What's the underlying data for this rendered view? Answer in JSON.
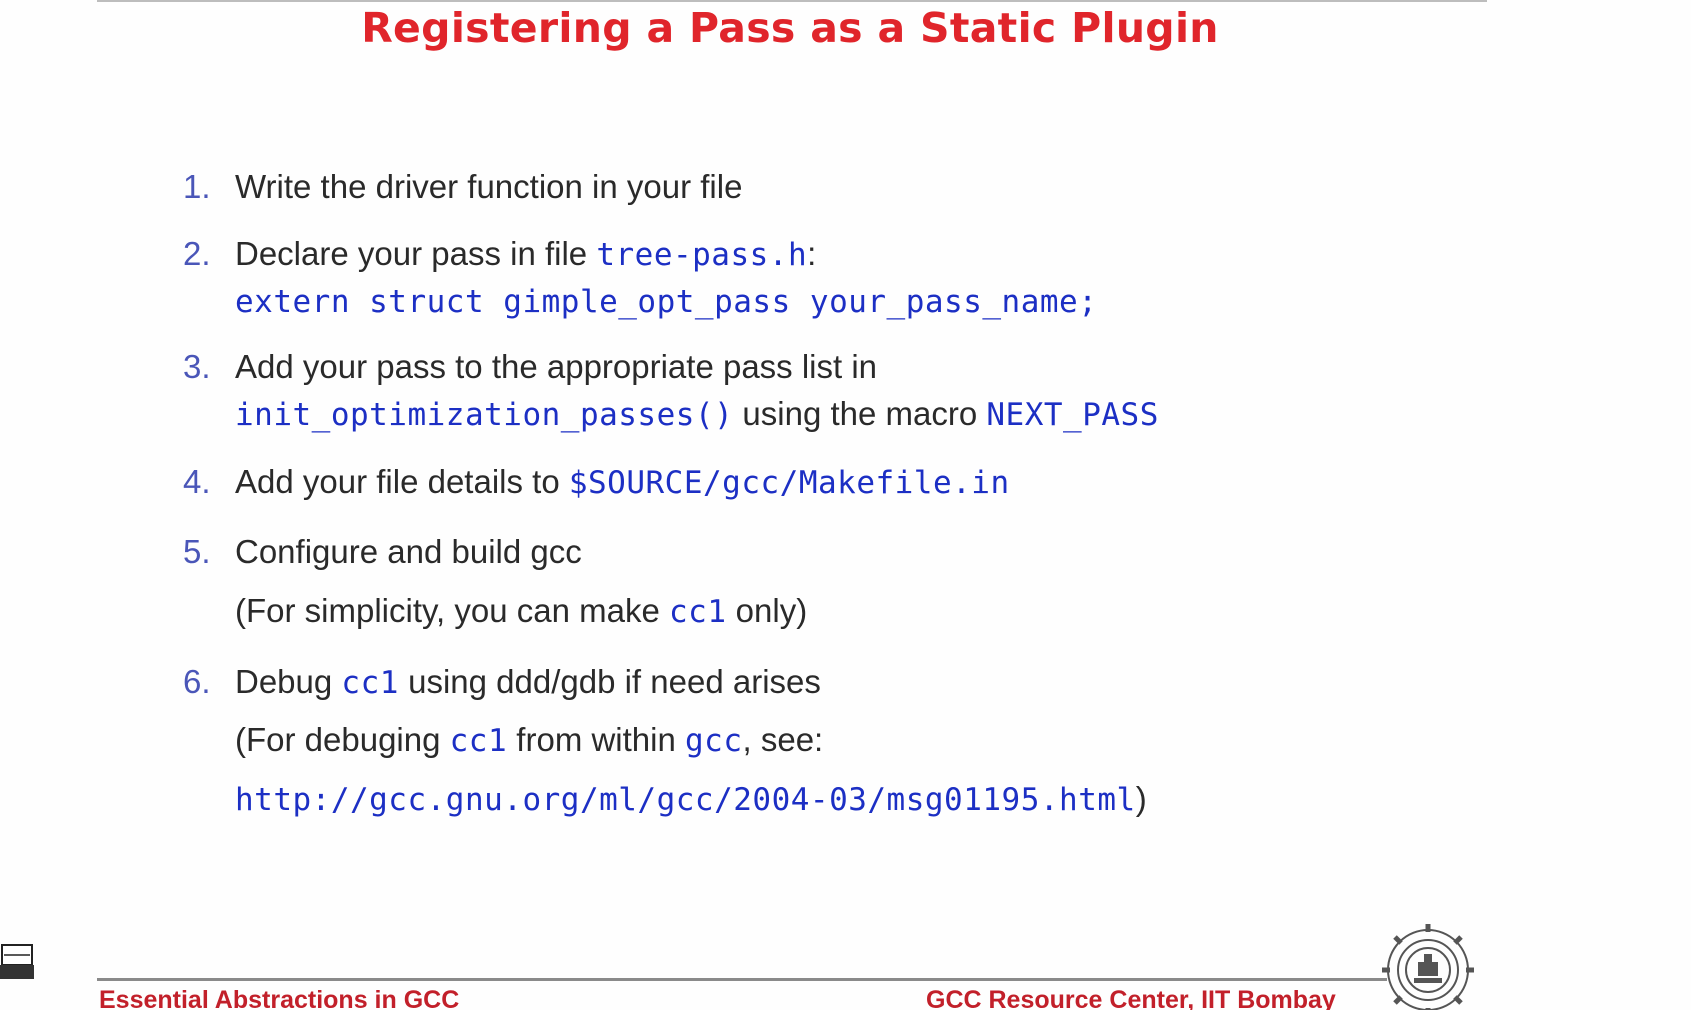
{
  "title": "Registering a Pass as a Static Plugin",
  "steps": [
    {
      "number": "1.",
      "lines": [
        [
          {
            "text": "Write the driver function in your file",
            "code": false
          }
        ]
      ]
    },
    {
      "number": "2.",
      "lines": [
        [
          {
            "text": "Declare your pass in file ",
            "code": false
          },
          {
            "text": "tree-pass.h",
            "code": true
          },
          {
            "text": ":",
            "code": false
          }
        ],
        [
          {
            "text": "extern struct gimple_opt_pass your_pass_name;",
            "code": true
          }
        ]
      ]
    },
    {
      "number": "3.",
      "lines": [
        [
          {
            "text": "Add your pass to the appropriate pass list in",
            "code": false
          }
        ],
        [
          {
            "text": "init_optimization_passes()",
            "code": true
          },
          {
            "text": " using the macro ",
            "code": false
          },
          {
            "text": "NEXT_PASS",
            "code": true
          }
        ]
      ]
    },
    {
      "number": "4.",
      "lines": [
        [
          {
            "text": "Add your file details to ",
            "code": false
          },
          {
            "text": "$SOURCE/gcc/Makefile.in",
            "code": true
          }
        ]
      ]
    },
    {
      "number": "5.",
      "lines": [
        [
          {
            "text": "Configure and build gcc",
            "code": false
          }
        ],
        [
          {
            "text": "(For simplicity, you can make ",
            "code": false
          },
          {
            "text": "cc1",
            "code": true
          },
          {
            "text": " only)",
            "code": false
          }
        ]
      ]
    },
    {
      "number": "6.",
      "lines": [
        [
          {
            "text": "Debug ",
            "code": false
          },
          {
            "text": "cc1",
            "code": true
          },
          {
            "text": " using ddd/gdb if need arises",
            "code": false
          }
        ],
        [
          {
            "text": "(For debuging ",
            "code": false
          },
          {
            "text": "cc1",
            "code": true
          },
          {
            "text": " from within ",
            "code": false
          },
          {
            "text": "gcc",
            "code": true
          },
          {
            "text": ", see:",
            "code": false
          }
        ],
        [
          {
            "text": "http://gcc.gnu.org/ml/gcc/2004-03/msg01195.html",
            "code": true
          },
          {
            "text": ")",
            "code": false
          }
        ]
      ]
    }
  ],
  "footer": {
    "left": "Essential Abstractions in GCC",
    "right": "GCC Resource Center, IIT Bombay"
  },
  "colors": {
    "title": "#e0252b",
    "code": "#1c2fc4",
    "number": "#4a56b8",
    "footer": "#c2202a"
  },
  "icons": {
    "logo": "iit-bombay-logo-icon",
    "laptop": "laptop-icon"
  }
}
